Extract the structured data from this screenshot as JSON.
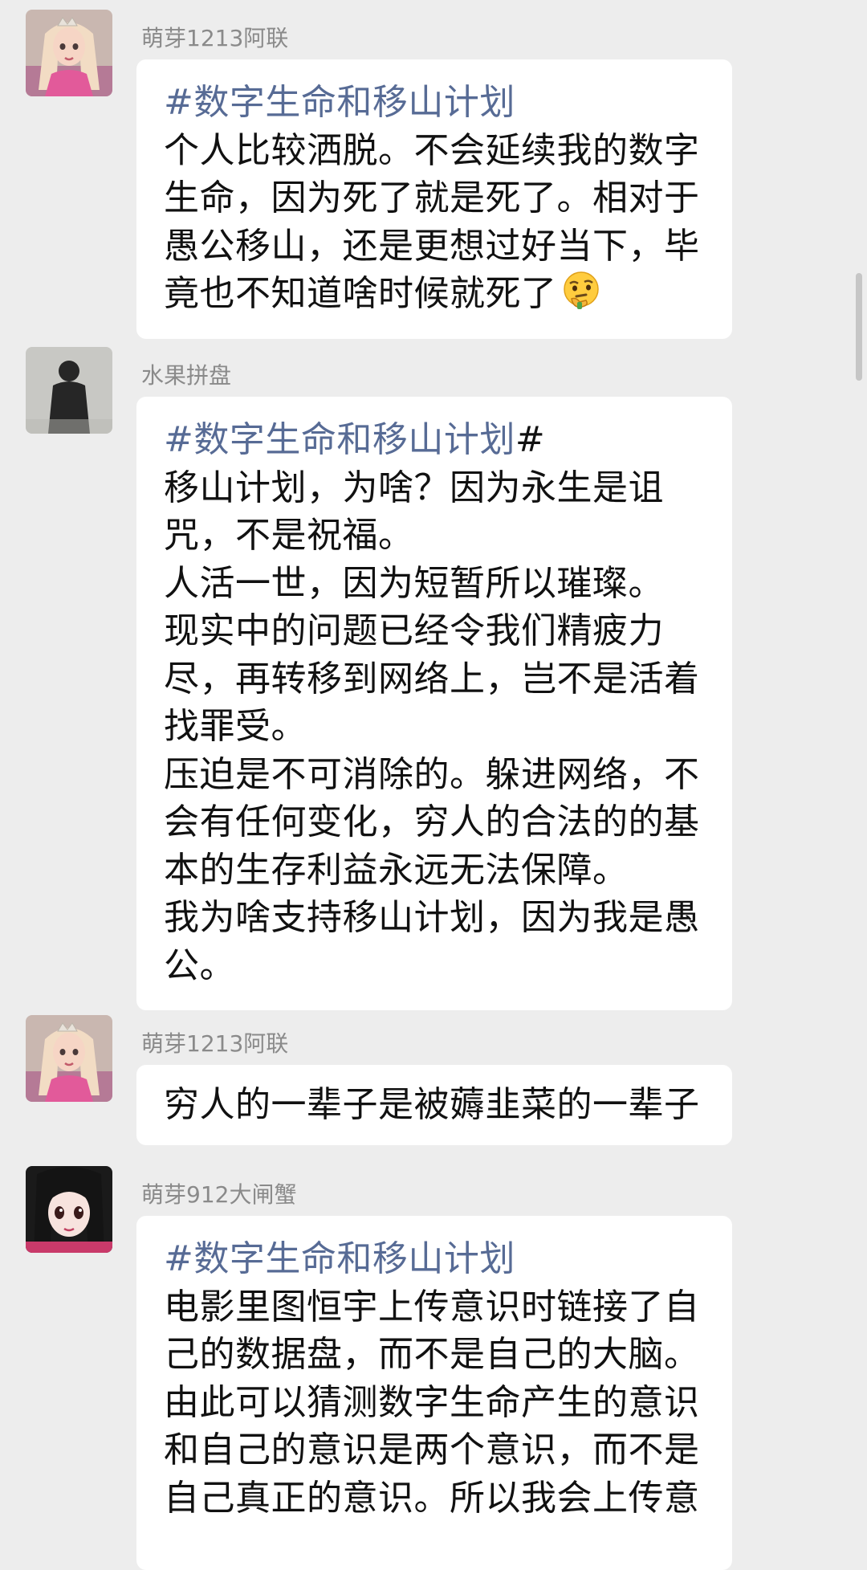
{
  "messages": [
    {
      "sender": "萌芽1213阿联",
      "avatar": "princess-avatar",
      "hashtag": "#数字生命和移山计划",
      "hashtag_suffix": "",
      "lines": [
        "个人比较洒脱。不会延续我的数字",
        "生命，因为死了就是死了。相对于",
        "愚公移山，还是更想过好当下，毕",
        "竟也不知道啥时候就死了"
      ],
      "emoji": "thinking-face-emoji"
    },
    {
      "sender": "水果拼盘",
      "avatar": "silhouette-avatar",
      "hashtag": "#数字生命和移山计划",
      "hashtag_suffix": "#",
      "lines": [
        "移山计划，为啥？因为永生是诅",
        "咒，不是祝福。",
        "人活一世，因为短暂所以璀璨。",
        "现实中的问题已经令我们精疲力",
        "尽，再转移到网络上，岂不是活着",
        "找罪受。",
        "压迫是不可消除的。躲进网络，不",
        "会有任何变化，穷人的合法的的基",
        "本的生存利益永远无法保障。",
        "我为啥支持移山计划，因为我是愚",
        "公。"
      ],
      "emoji": ""
    },
    {
      "sender": "萌芽1213阿联",
      "avatar": "princess-avatar",
      "hashtag": "",
      "hashtag_suffix": "",
      "lines": [
        "穷人的一辈子是被薅韭菜的一辈子"
      ],
      "emoji": ""
    },
    {
      "sender": "萌芽912大闸蟹",
      "avatar": "anime-girl-avatar",
      "hashtag": "#数字生命和移山计划",
      "hashtag_suffix": "",
      "lines": [
        "电影里图恒宇上传意识时链接了自",
        "己的数据盘，而不是自己的大脑。",
        "由此可以猜测数字生命产生的意识",
        "和自己的意识是两个意识，而不是",
        "自己真正的意识。所以我会上传意"
      ],
      "emoji": ""
    }
  ],
  "colors": {
    "background": "#ededed",
    "bubble": "#ffffff",
    "hashtag": "#576b95",
    "sender": "#8a8a8a",
    "text": "#111111",
    "scrollbar": "#c6c6c6"
  }
}
